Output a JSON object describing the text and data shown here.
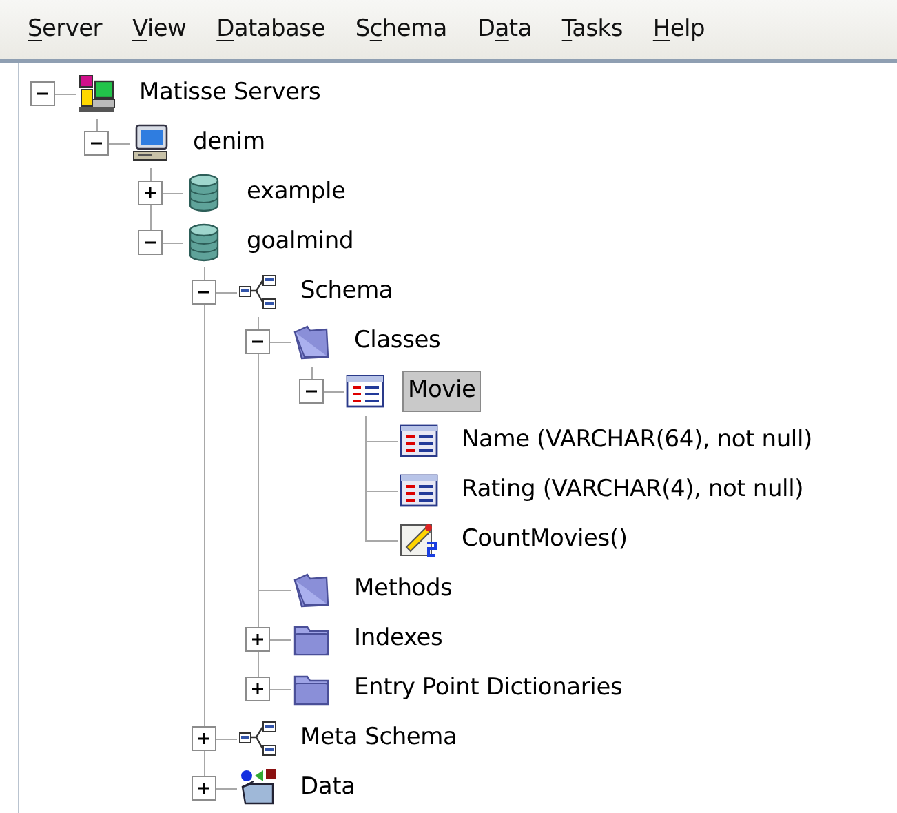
{
  "menu": [
    {
      "key": "S",
      "after": "erver"
    },
    {
      "key": "V",
      "after": "iew"
    },
    {
      "key": "D",
      "after": "atabase"
    },
    {
      "before": "S",
      "key": "c",
      "after": "hema"
    },
    {
      "before": "D",
      "key": "a",
      "after": "ta"
    },
    {
      "key": "T",
      "after": "asks"
    },
    {
      "key": "H",
      "after": "elp"
    }
  ],
  "tree": [
    {
      "label": "Matisse Servers",
      "kind": "servers",
      "expanded": true,
      "selected": false,
      "children": [
        {
          "label": "denim",
          "kind": "computer",
          "expanded": true,
          "selected": false,
          "children": [
            {
              "label": "example",
              "kind": "database",
              "expanded": false,
              "selected": false
            },
            {
              "label": "goalmind",
              "kind": "database",
              "expanded": true,
              "selected": false,
              "children": [
                {
                  "label": "Schema",
                  "kind": "schema",
                  "expanded": true,
                  "selected": false,
                  "children": [
                    {
                      "label": "Classes",
                      "kind": "open-folder",
                      "expanded": true,
                      "selected": false,
                      "children": [
                        {
                          "label": "Movie",
                          "kind": "class",
                          "expanded": true,
                          "selected": true,
                          "children": [
                            {
                              "label": "Name (VARCHAR(64), not null)",
                              "kind": "attribute",
                              "selected": false
                            },
                            {
                              "label": "Rating (VARCHAR(4), not null)",
                              "kind": "attribute",
                              "selected": false
                            },
                            {
                              "label": "CountMovies()",
                              "kind": "method",
                              "selected": false
                            }
                          ]
                        }
                      ]
                    },
                    {
                      "label": "Methods",
                      "kind": "open-folder",
                      "selected": false
                    },
                    {
                      "label": "Indexes",
                      "kind": "folder",
                      "expanded": false,
                      "selected": false
                    },
                    {
                      "label": "Entry Point Dictionaries",
                      "kind": "folder",
                      "expanded": false,
                      "selected": false
                    }
                  ]
                },
                {
                  "label": "Meta Schema",
                  "kind": "schema",
                  "expanded": false,
                  "selected": false
                },
                {
                  "label": "Data",
                  "kind": "data",
                  "expanded": false,
                  "selected": false
                }
              ]
            }
          ]
        }
      ]
    }
  ]
}
